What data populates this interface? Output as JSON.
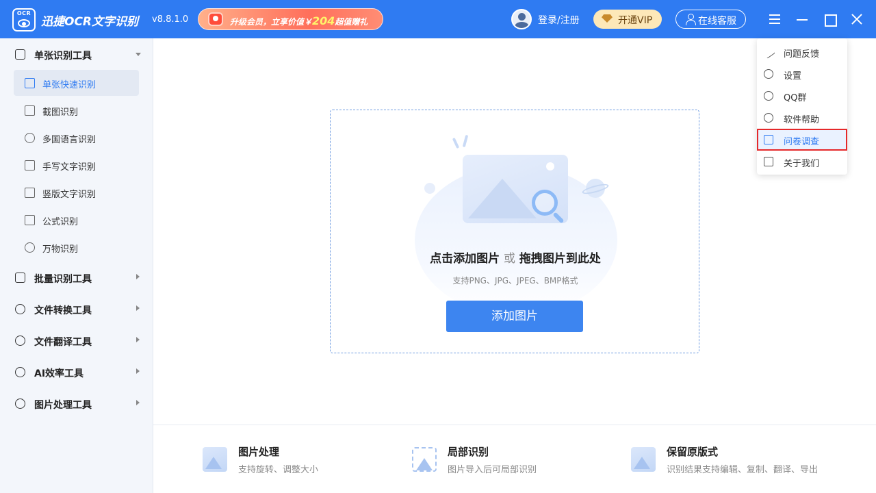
{
  "titlebar": {
    "logo_text": "OCR",
    "app_name": "迅捷OCR文字识别",
    "version": "v8.8.1.0",
    "promo_text": "升级会员，立享价值￥",
    "promo_value": "204",
    "promo_suffix": "超值赠礼",
    "login_label": "登录/注册",
    "vip_label": "开通VIP",
    "service_label": "在线客服"
  },
  "sidebar": {
    "groups": [
      {
        "label": "单张识别工具",
        "expanded": true,
        "icon": "single-recognition-icon"
      },
      {
        "label": "批量识别工具",
        "icon": "batch-recognition-icon"
      },
      {
        "label": "文件转换工具",
        "icon": "file-convert-icon"
      },
      {
        "label": "文件翻译工具",
        "icon": "file-translate-icon"
      },
      {
        "label": "AI效率工具",
        "icon": "ai-icon"
      },
      {
        "label": "图片处理工具",
        "icon": "image-process-icon"
      }
    ],
    "sub_items": [
      {
        "label": "单张快速识别",
        "icon": "quick-recognize-icon",
        "active": true
      },
      {
        "label": "截图识别",
        "icon": "crop-icon"
      },
      {
        "label": "多国语言识别",
        "icon": "globe-icon"
      },
      {
        "label": "手写文字识别",
        "icon": "pen-icon"
      },
      {
        "label": "竖版文字识别",
        "icon": "vertical-text-icon"
      },
      {
        "label": "公式识别",
        "icon": "formula-icon"
      },
      {
        "label": "万物识别",
        "icon": "objects-icon"
      }
    ]
  },
  "dropzone": {
    "main_text_a": "点击添加图片",
    "or_text": "或",
    "main_text_b": "拖拽图片到此处",
    "hint": "支持PNG、JPG、JPEG、BMP格式",
    "button_label": "添加图片"
  },
  "features": [
    {
      "title": "图片处理",
      "desc": "支持旋转、调整大小"
    },
    {
      "title": "局部识别",
      "desc": "图片导入后可局部识别"
    },
    {
      "title": "保留原版式",
      "desc": "识别结果支持编辑、复制、翻译、导出"
    }
  ],
  "menu": {
    "items": [
      {
        "label": "问题反馈",
        "icon": "feedback-icon"
      },
      {
        "label": "设置",
        "icon": "gear-icon"
      },
      {
        "label": "QQ群",
        "icon": "qq-icon"
      },
      {
        "label": "软件帮助",
        "icon": "help-icon"
      },
      {
        "label": "问卷调查",
        "icon": "survey-icon",
        "highlighted": true
      },
      {
        "label": "关于我们",
        "icon": "about-icon"
      }
    ]
  },
  "colors": {
    "primary": "#2f7bf2",
    "highlight_border": "#e5282a",
    "vip_bg": "#fde8b8"
  }
}
